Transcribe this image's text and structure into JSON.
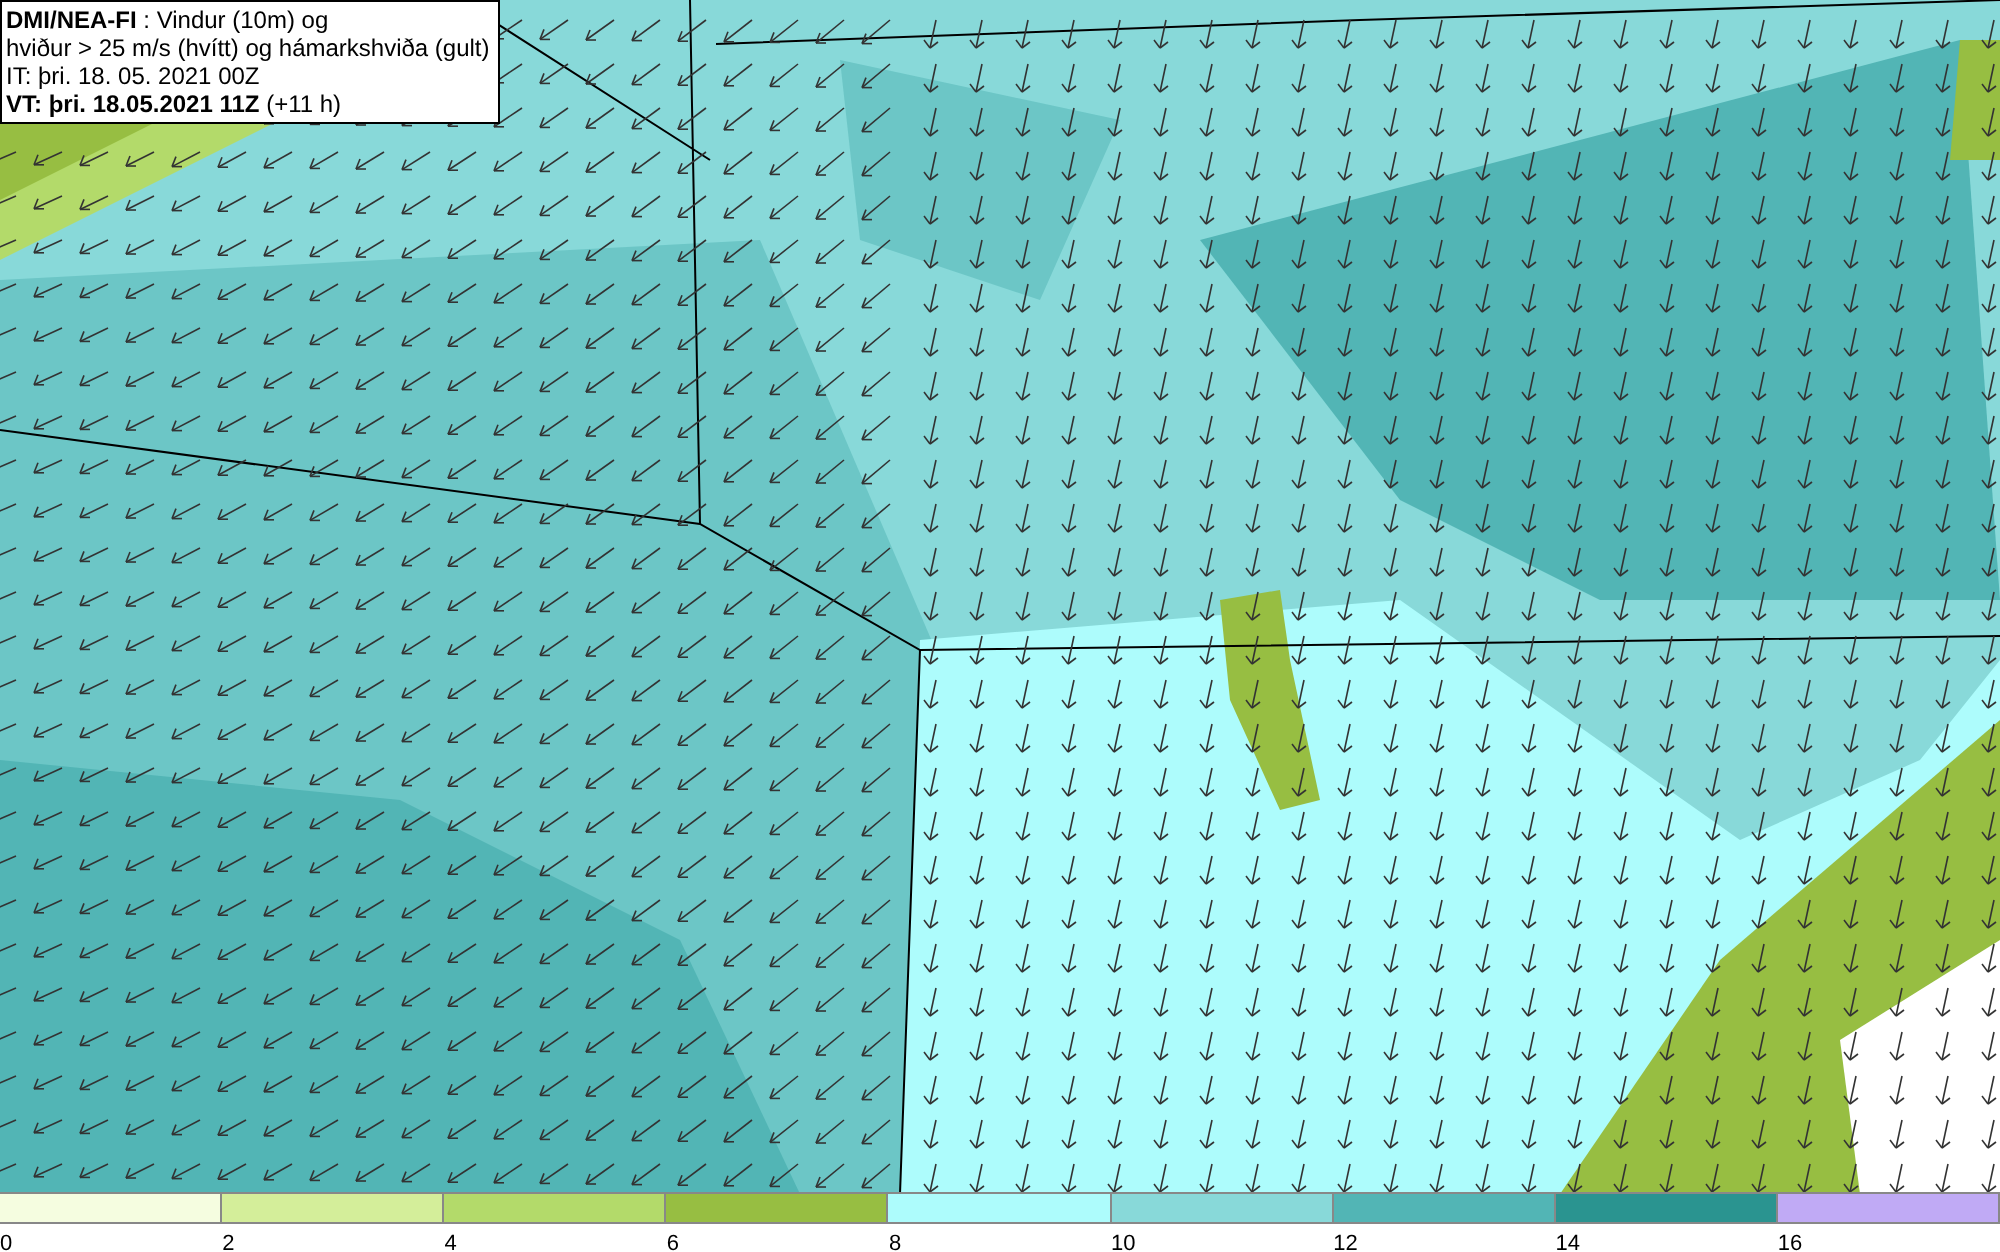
{
  "info_box": {
    "lines": [
      "**DMI/NEA-FI** : Vindur (10m) og",
      "hviður > 25 m/s (hvítt) og hámarkshviða (gult)",
      "IT: þri. 18. 05. 2021 00Z",
      "**VT: þri. 18.05.2021 11Z** (+11 h)"
    ]
  },
  "legend": {
    "cells": [
      {
        "label": "0",
        "color": "#f5fde0"
      },
      {
        "label": "2",
        "color": "#d4ee9a"
      },
      {
        "label": "4",
        "color": "#b3da6a"
      },
      {
        "label": "6",
        "color": "#97be42"
      },
      {
        "label": "8",
        "color": "#adfcfc"
      },
      {
        "label": "10",
        "color": "#88d9d9"
      },
      {
        "label": "12",
        "color": "#52b5b5"
      },
      {
        "label": "14",
        "color": "#2a9490"
      },
      {
        "label": "16",
        "color": "#c0aaf5"
      }
    ]
  }
}
